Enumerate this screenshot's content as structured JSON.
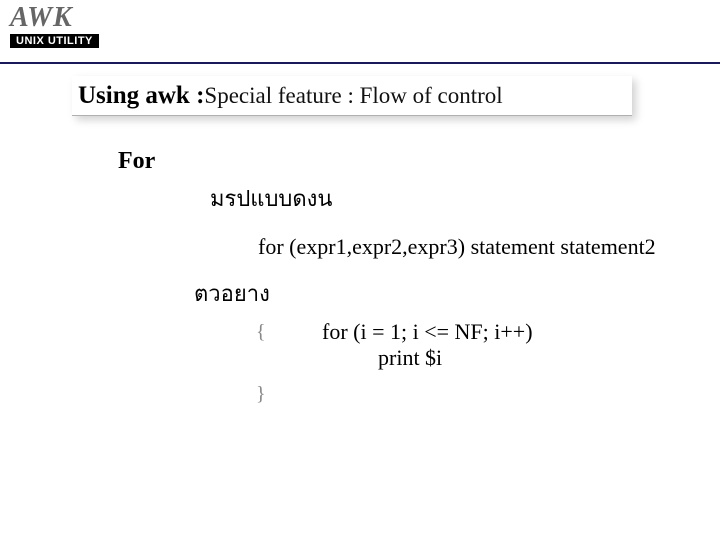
{
  "logo": {
    "main": "AWK",
    "sub": "UNIX UTILITY"
  },
  "title": {
    "bold": "Using awk : ",
    "normal": "Special feature : Flow of control"
  },
  "section": {
    "header": "For",
    "form_label": "มรปแบบดงน",
    "syntax": "for (expr1,expr2,expr3) statement statement2",
    "example_label": "ตวอยาง",
    "brace_open": "{",
    "brace_close": "}",
    "code_line1": "for (i = 1; i <= NF; i++)",
    "code_line2": "print $i"
  }
}
